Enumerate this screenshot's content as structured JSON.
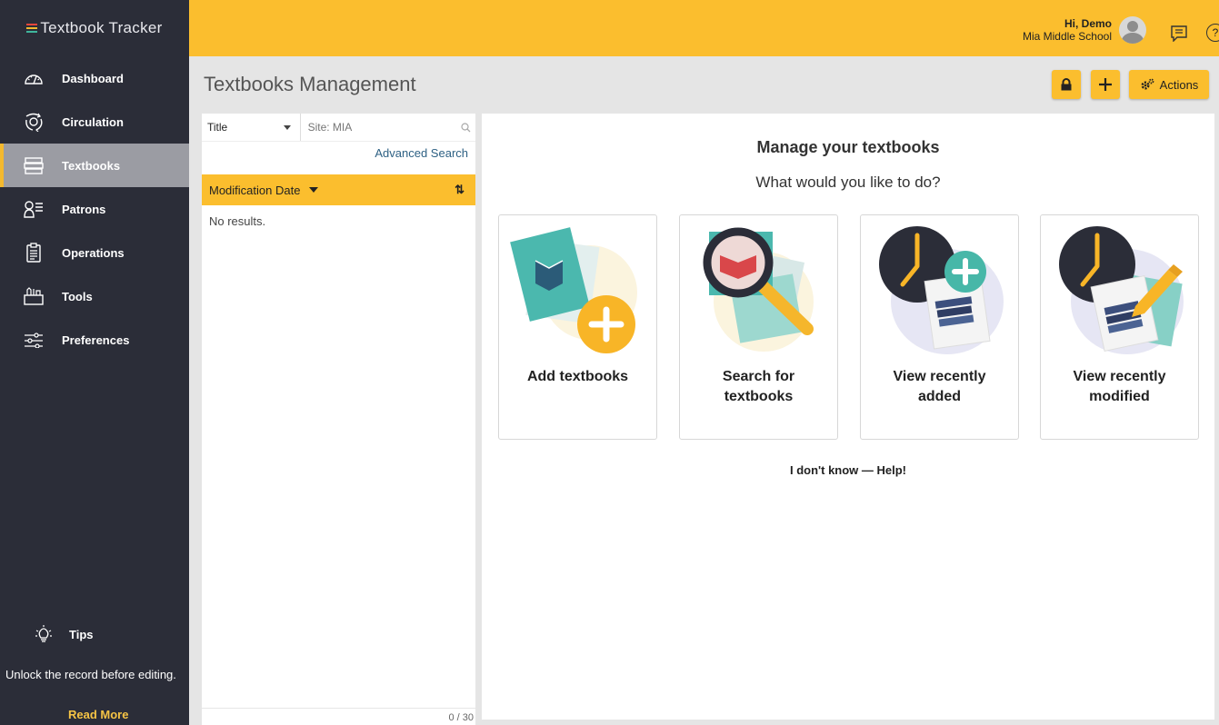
{
  "app": {
    "title": "Textbook Tracker"
  },
  "colors": {
    "accent": "#fbbe2e",
    "sidebar": "#2b2d38",
    "active": "#9b9ca3",
    "link": "#2e6184"
  },
  "sidebar": {
    "items": [
      {
        "label": "Dashboard",
        "icon": "gauge-icon"
      },
      {
        "label": "Circulation",
        "icon": "circulation-icon"
      },
      {
        "label": "Textbooks",
        "icon": "books-icon",
        "active": true
      },
      {
        "label": "Patrons",
        "icon": "patrons-icon"
      },
      {
        "label": "Operations",
        "icon": "clipboard-icon"
      },
      {
        "label": "Tools",
        "icon": "tools-icon"
      },
      {
        "label": "Preferences",
        "icon": "sliders-icon"
      }
    ],
    "tips": {
      "heading": "Tips",
      "text": "Unlock the record before editing.",
      "link": "Read More"
    }
  },
  "header": {
    "greeting": "Hi, Demo",
    "school": "Mia Middle School",
    "help_symbol": "?"
  },
  "page": {
    "title": "Textbooks Management",
    "toolbar": {
      "lock_icon": "lock-icon",
      "add_icon": "plus-icon",
      "actions_label": "Actions"
    }
  },
  "search": {
    "field": "Title",
    "placeholder": "Site: MIA",
    "advanced_label": "Advanced Search",
    "sort_label": "Modification Date",
    "sort_order_glyph": "⇅",
    "no_results": "No results.",
    "page_info": "0 / 30"
  },
  "main": {
    "heading": "Manage your textbooks",
    "subheading": "What would you like to do?",
    "cards": [
      {
        "label": "Add textbooks"
      },
      {
        "label": "Search for textbooks"
      },
      {
        "label": "View recently added"
      },
      {
        "label": "View recently modified"
      }
    ],
    "help_link": "I don't know — Help!"
  }
}
